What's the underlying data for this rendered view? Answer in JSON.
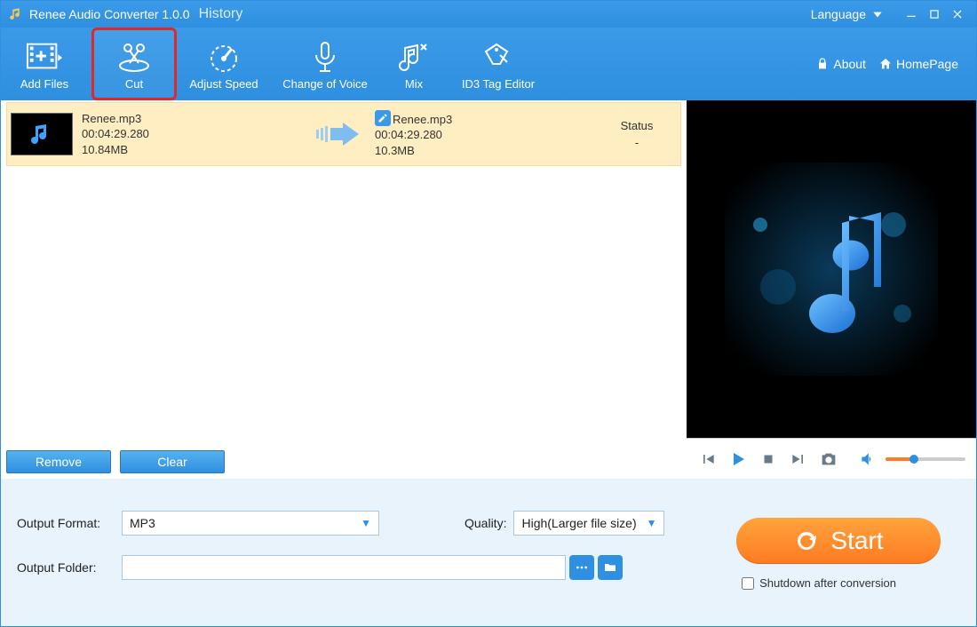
{
  "titlebar": {
    "app_title": "Renee Audio Converter 1.0.0",
    "history_link": "History",
    "language_label": "Language"
  },
  "toolbar": {
    "add_files": "Add Files",
    "cut": "Cut",
    "adjust_speed": "Adjust Speed",
    "change_voice": "Change of Voice",
    "mix": "Mix",
    "id3_tag": "ID3 Tag Editor",
    "about": "About",
    "homepage": "HomePage"
  },
  "file": {
    "in_name": "Renee.mp3",
    "in_duration": "00:04:29.280",
    "in_size": "10.84MB",
    "out_name": "Renee.mp3",
    "out_duration": "00:04:29.280",
    "out_size": "10.3MB",
    "status_label": "Status",
    "status_value": "-"
  },
  "buttons": {
    "remove": "Remove",
    "clear": "Clear"
  },
  "player": {
    "volume_percent": 35
  },
  "output": {
    "format_label": "Output Format:",
    "format_value": "MP3",
    "quality_label": "Quality:",
    "quality_value": "High(Larger file size)",
    "folder_label": "Output Folder:",
    "folder_value": ""
  },
  "start": {
    "label": "Start"
  },
  "shutdown": {
    "label": "Shutdown after conversion",
    "checked": false
  },
  "colors": {
    "brand_blue": "#2f8fe0",
    "orange": "#ff7a22",
    "highlight_red": "#e02828",
    "row_bg": "#ffeec1"
  }
}
